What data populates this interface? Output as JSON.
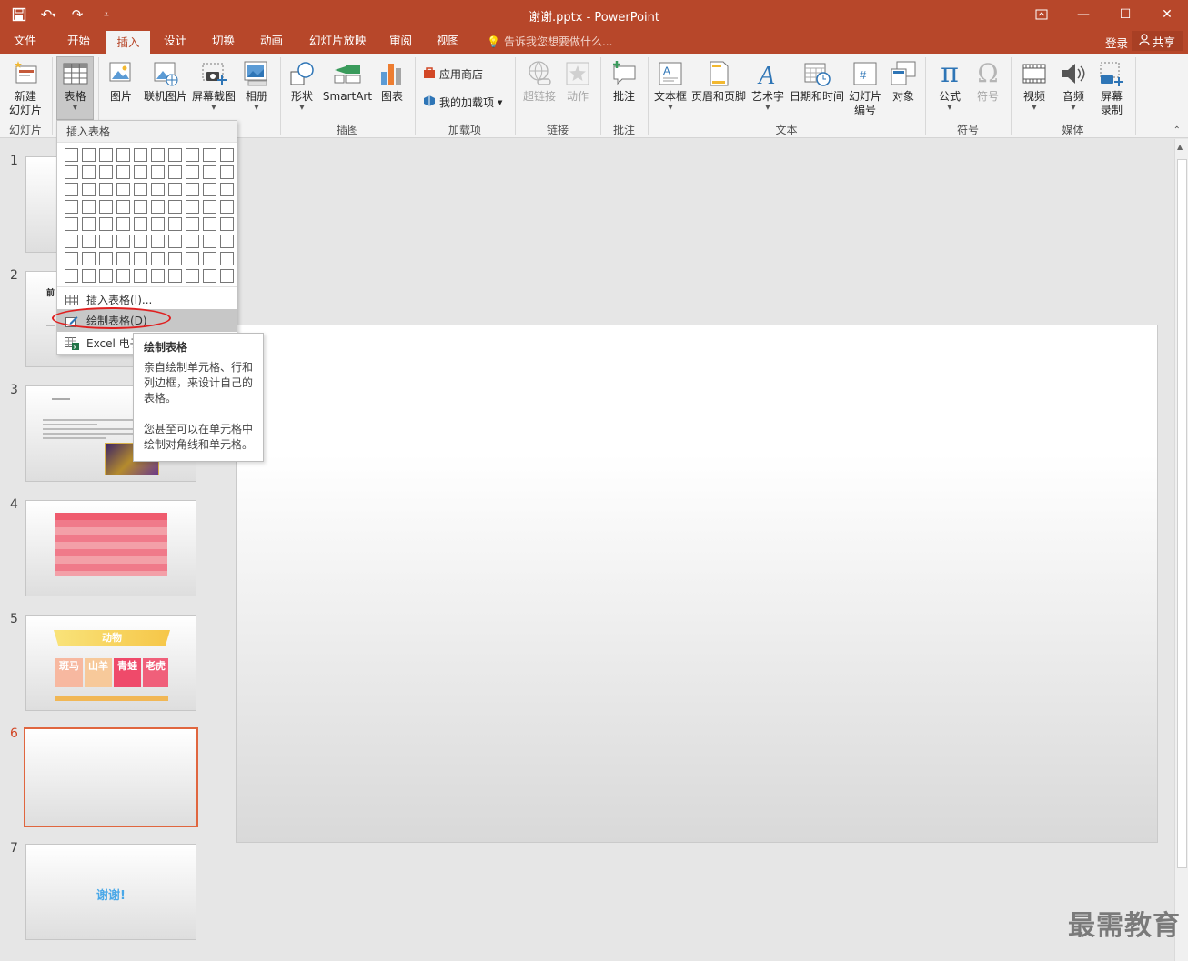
{
  "window": {
    "title": "谢谢.pptx - PowerPoint"
  },
  "tabs": [
    {
      "label": "文件"
    },
    {
      "label": "开始"
    },
    {
      "label": "插入"
    },
    {
      "label": "设计"
    },
    {
      "label": "切换"
    },
    {
      "label": "动画"
    },
    {
      "label": "幻灯片放映"
    },
    {
      "label": "审阅"
    },
    {
      "label": "视图"
    }
  ],
  "active_tab": "插入",
  "tell_me": "告诉我您想要做什么...",
  "account": {
    "signin": "登录",
    "share": "共享"
  },
  "ribbon": {
    "new_slide": "新建\n幻灯片",
    "table": "表格",
    "picture": "图片",
    "online_picture": "联机图片",
    "screenshot": "屏幕截图",
    "album": "相册",
    "shapes": "形状",
    "smartart": "SmartArt",
    "chart": "图表",
    "store": "应用商店",
    "my_addins": "我的加载项",
    "hyperlink": "超链接",
    "action": "动作",
    "comment": "批注",
    "textbox": "文本框",
    "header_footer": "页眉和页脚",
    "wordart": "艺术字",
    "datetime": "日期和时间",
    "slide_number": "幻灯片\n编号",
    "object": "对象",
    "equation": "公式",
    "symbol": "符号",
    "video": "视频",
    "audio": "音频",
    "screen_record": "屏幕\n录制",
    "groups": {
      "slides": "幻灯片",
      "illustrations": "插图",
      "addins": "加载项",
      "links": "链接",
      "comments": "批注",
      "text": "文本",
      "symbols": "符号",
      "media": "媒体"
    }
  },
  "dropdown": {
    "header": "插入表格",
    "items": [
      {
        "label": "插入表格(I)..."
      },
      {
        "label": "绘制表格(D)"
      },
      {
        "label": "Excel 电子"
      }
    ]
  },
  "tooltip": {
    "title": "绘制表格",
    "p1": "亲自绘制单元格、行和列边框，来设计自己的表格。",
    "p2": "您甚至可以在单元格中绘制对角线和单元格。"
  },
  "slides": [
    {
      "number": "1"
    },
    {
      "number": "2",
      "text": "前"
    },
    {
      "number": "3"
    },
    {
      "number": "4"
    },
    {
      "number": "5",
      "title": "动物",
      "cards": [
        "斑马",
        "山羊",
        "青蛙",
        "老虎"
      ]
    },
    {
      "number": "6"
    },
    {
      "number": "7",
      "text": "谢谢!"
    }
  ],
  "selected_slide": "6",
  "watermark": "最需教育",
  "colors": {
    "accent": "#b7472a",
    "selection": "#e0663f",
    "highlight_circle": "#e02020"
  }
}
